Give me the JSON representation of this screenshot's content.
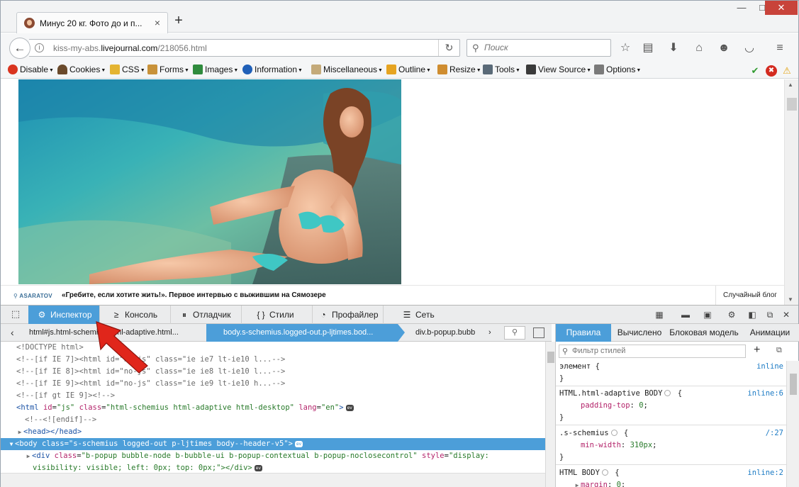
{
  "tab": {
    "title": "Минус 20 кг. Фото до и п...",
    "close": "×",
    "new_tab": "+"
  },
  "window_controls": {
    "minimize": "—",
    "maximize": "□",
    "close": "✕"
  },
  "nav": {
    "url_prefix": "kiss-my-abs.",
    "url_domain": "livejournal.com",
    "url_path": "/218056.html",
    "search_placeholder": "Поиск"
  },
  "devbar": {
    "items": [
      {
        "label": "Disable",
        "color": "#d9341f"
      },
      {
        "label": "Cookies",
        "color": "#6a4a2c"
      },
      {
        "label": "CSS",
        "color": "#e4b432"
      },
      {
        "label": "Forms",
        "color": "#c8923a"
      },
      {
        "label": "Images",
        "color": "#2f8b3d"
      },
      {
        "label": "Information",
        "color": "#2060b8"
      },
      {
        "label": "Miscellaneous",
        "color": "#c4aa7a"
      },
      {
        "label": "Outline",
        "color": "#e6a421"
      },
      {
        "label": "Resize",
        "color": "#cf8d30"
      },
      {
        "label": "Tools",
        "color": "#5a6a78"
      },
      {
        "label": "View Source",
        "color": "#3a3a3a"
      },
      {
        "label": "Options",
        "color": "#7a7a7a"
      }
    ]
  },
  "page": {
    "author": "ASARATOV",
    "headline": "«Гребите, если хотите жить!». Первое интервью с выжившим на Сямозере",
    "random_blog": "Случайный блог"
  },
  "devtools": {
    "tabs": [
      {
        "label": "Инспектор",
        "icon": "⚙"
      },
      {
        "label": "Консоль",
        "icon": "≥"
      },
      {
        "label": "Отладчик",
        "icon": "⏸"
      },
      {
        "label": "Стили",
        "icon": "{ }"
      },
      {
        "label": "Профайлер",
        "icon": "◔"
      },
      {
        "label": "Сеть",
        "icon": "☰"
      }
    ],
    "breadcrumbs": [
      "html#js.html-schemius.html-adaptive.html...",
      "body.s-schemius.logged-out.p-ljtimes.bod...",
      "div.b-popup.bubb"
    ],
    "side_tabs": [
      "Правила",
      "Вычислено",
      "Блоковая модель",
      "Анимации"
    ],
    "filter_placeholder": "Фильтр стилей",
    "markup": [
      "<!DOCTYPE html>",
      "<!--[if IE 7]><html id=\"no-js\" class=\"ie ie7 lt-ie10 l...-->",
      "<!--[if IE 8]><html id=\"no-js\" class=\"ie ie8 lt-ie10 l...-->",
      "<!--[if IE 9]><html id=\"no-js\" class=\"ie ie9 lt-ie10 h...-->",
      "<!--[if gt IE 9]><!-->"
    ],
    "html_line": {
      "tag": "html",
      "id_attr": "id",
      "id_val": "\"js\"",
      "class_attr": "class",
      "class_val": "\"html-schemius html-adaptive html-desktop\"",
      "lang_attr": "lang",
      "lang_val": "\"en\""
    },
    "endif_line": "<!--<![endif]-->",
    "head_line": "<head></head>",
    "body_line": {
      "tag": "body",
      "class_attr": "class",
      "class_val": "\"s-schemius logged-out p-ljtimes body--header-v5\""
    },
    "div_line": {
      "tag": "div",
      "class_attr": "class",
      "class_val": "\"b-popup bubble-node b-bubble-ui b-popup-contextual b-popup-noclosecontrol\"",
      "style_attr": "style",
      "style_val": "\"display:",
      "cont": "visibility: visible; left: 0px; top: 0px;\"></div>"
    },
    "rules": {
      "r1_sel": "элемент {",
      "r1_src": "inline",
      "r1_close": "}",
      "r2_sel": "HTML.html-adaptive BODY",
      "r2_src": "inline:6",
      "r2_prop": "padding-top",
      "r2_val": "0",
      "r2_close": "}",
      "r3_sel": ".s-schemius",
      "r3_src": "/:27",
      "r3_prop": "min-width",
      "r3_val": "310px",
      "r3_close": "}",
      "r4_sel": "HTML BODY",
      "r4_src": "inline:2",
      "r4_prop": "margin",
      "r4_val": "0"
    },
    "ev": "ev"
  },
  "colors": {
    "accent": "#4c9ed9",
    "annotation": "#e0261b"
  }
}
